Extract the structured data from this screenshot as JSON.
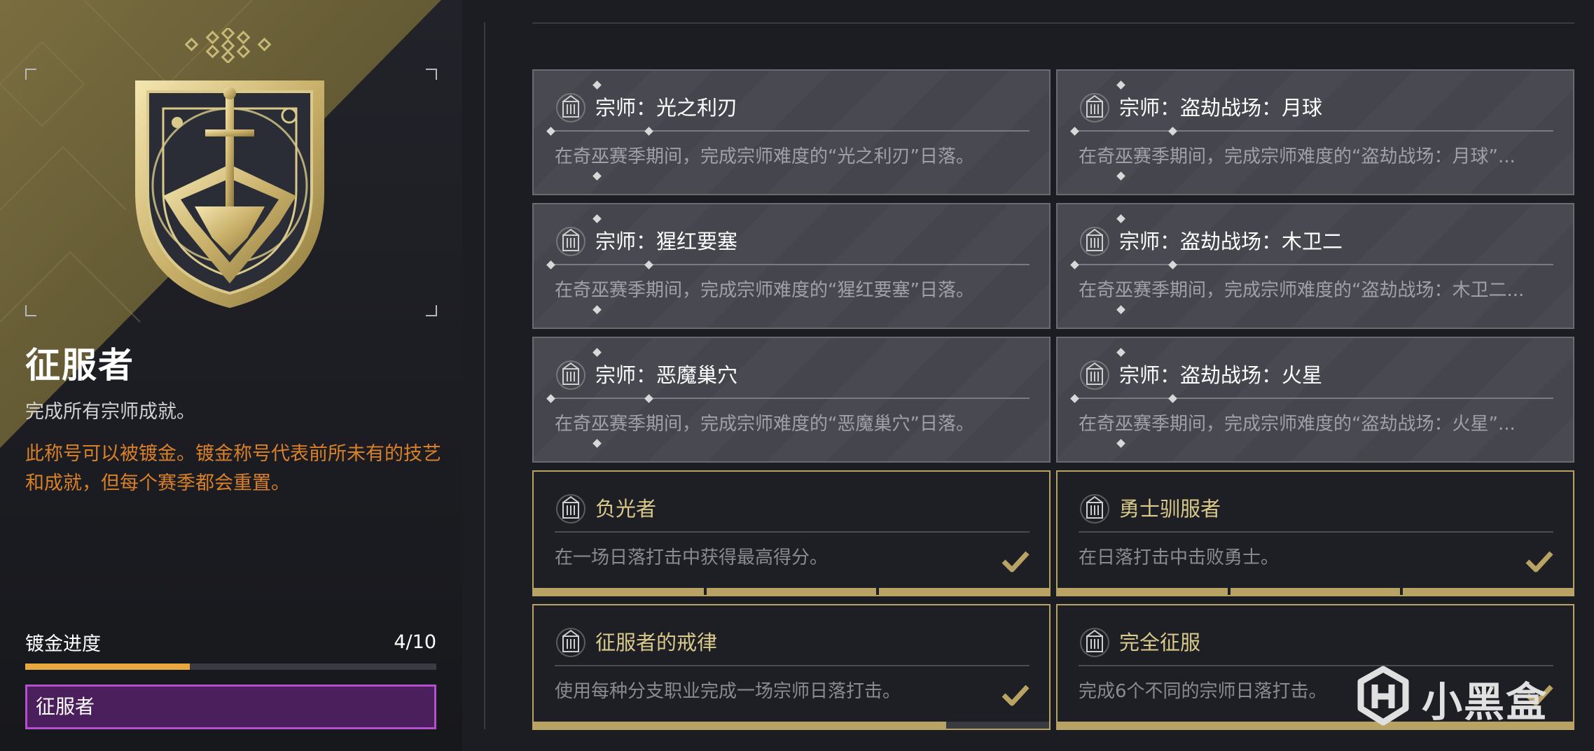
{
  "title_panel": {
    "name": "征服者",
    "description": "完成所有宗师成就。",
    "gild_note": "此称号可以被镀金。镀金称号代表前所未有的技艺和成就，但每个赛季都会重置。",
    "gild_progress_label": "镀金进度",
    "gild_progress_value": "4/10",
    "gild_progress_fraction": 0.4,
    "equipped_title": "征服者"
  },
  "cards": [
    {
      "title": "宗师：光之利刃",
      "description": "在奇巫赛季期间，完成宗师难度的“光之利刃”日落。",
      "completed": false
    },
    {
      "title": "宗师：盗劫战场：月球",
      "description": "在奇巫赛季期间，完成宗师难度的“盗劫战场：月球”...",
      "completed": false
    },
    {
      "title": "宗师：猩红要塞",
      "description": "在奇巫赛季期间，完成宗师难度的“猩红要塞”日落。",
      "completed": false
    },
    {
      "title": "宗师：盗劫战场：木卫二",
      "description": "在奇巫赛季期间，完成宗师难度的“盗劫战场：木卫二...",
      "completed": false
    },
    {
      "title": "宗师：恶魔巢穴",
      "description": "在奇巫赛季期间，完成宗师难度的“恶魔巢穴”日落。",
      "completed": false
    },
    {
      "title": "宗师：盗劫战场：火星",
      "description": "在奇巫赛季期间，完成宗师难度的“盗劫战场：火星”...",
      "completed": false
    },
    {
      "title": "负光者",
      "description": "在一场日落打击中获得最高得分。",
      "completed": true,
      "progress_style": "segments",
      "segments": 3
    },
    {
      "title": "勇士驯服者",
      "description": "在日落打击中击败勇士。",
      "completed": true,
      "progress_style": "segments",
      "segments": 3
    },
    {
      "title": "征服者的戒律",
      "description": "使用每种分支职业完成一场宗师日落打击。",
      "completed": true,
      "progress_style": "bar",
      "progress": 0.8
    },
    {
      "title": "完全征服",
      "description": "完成6个不同的宗师日落打击。",
      "completed": true,
      "progress_style": "bar",
      "progress": 1.0
    }
  ],
  "icons": {
    "card": "tower-emblem-icon",
    "check": "checkmark-icon",
    "crest": "conqueror-seal-icon"
  },
  "colors": {
    "gold": "#b8a364",
    "gild_orange": "#d8802a",
    "progress_fill": "#e8a840",
    "title_purple": "#4b1f5c",
    "title_border": "#b44fd0"
  },
  "watermark": {
    "text": "小黑盒"
  }
}
